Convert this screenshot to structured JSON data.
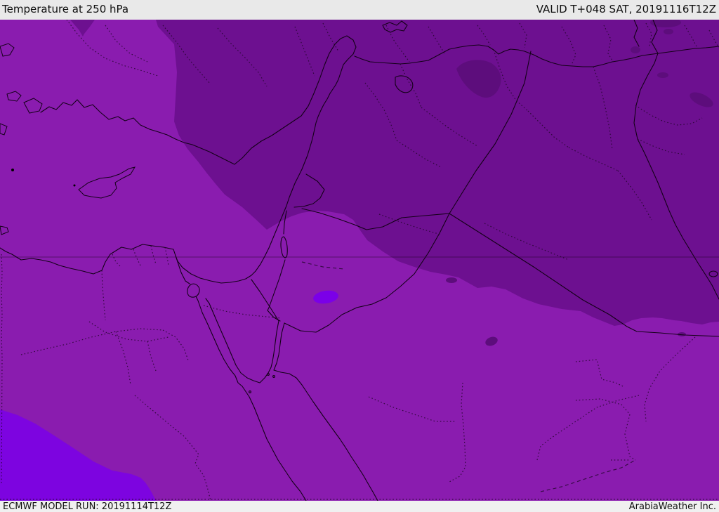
{
  "header": {
    "title": "Temperature at 250 hPa",
    "valid": "VALID T+048 SAT, 20191116T12Z"
  },
  "footer": {
    "model_run": "ECMWF MODEL RUN: 20191114T12Z",
    "brand": "ArabiaWeather Inc."
  },
  "map": {
    "description": "ECMWF 250 hPa temperature field over the Middle East and Eastern Mediterranean",
    "colors": {
      "base": "#8A1CAF",
      "dark": "#6D1090",
      "darker": "#5D0D7C",
      "bright": "#7D04E0",
      "brighter_spot": "#7B00E8",
      "border_line": "#140018",
      "admin_dot": "#24062e",
      "parallel_line": "#D9A6E8",
      "header_bg": "#E9E9E9",
      "footer_bg": "#F0F0F0",
      "text": "#0F0F0F"
    }
  }
}
